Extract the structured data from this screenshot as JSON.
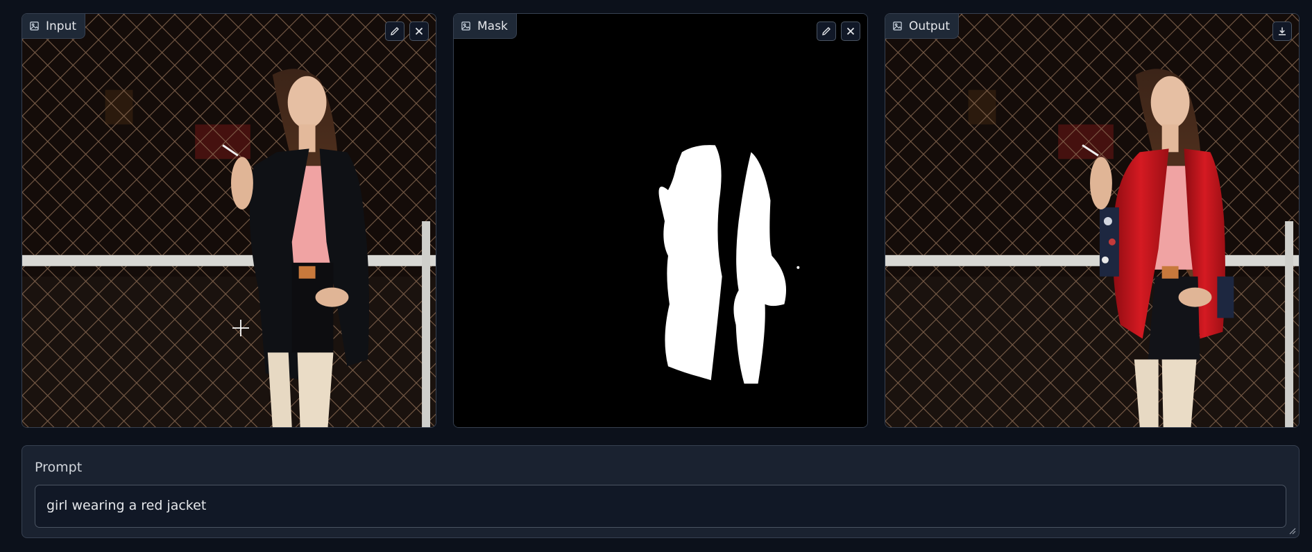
{
  "panels": {
    "input": {
      "label": "Input",
      "icon": "image-icon",
      "tools": [
        "edit-icon",
        "close-icon"
      ]
    },
    "mask": {
      "label": "Mask",
      "icon": "image-icon",
      "tools": [
        "edit-icon",
        "close-icon"
      ]
    },
    "output": {
      "label": "Output",
      "icon": "image-icon",
      "tools": [
        "download-icon"
      ]
    }
  },
  "prompt": {
    "label": "Prompt",
    "value": "girl wearing a red jacket"
  },
  "colors": {
    "background": "#0c111b",
    "panel_border": "#374151",
    "jacket_input": "#0f1115",
    "jacket_output": "#c8141c",
    "top": "#f0a3a3"
  }
}
